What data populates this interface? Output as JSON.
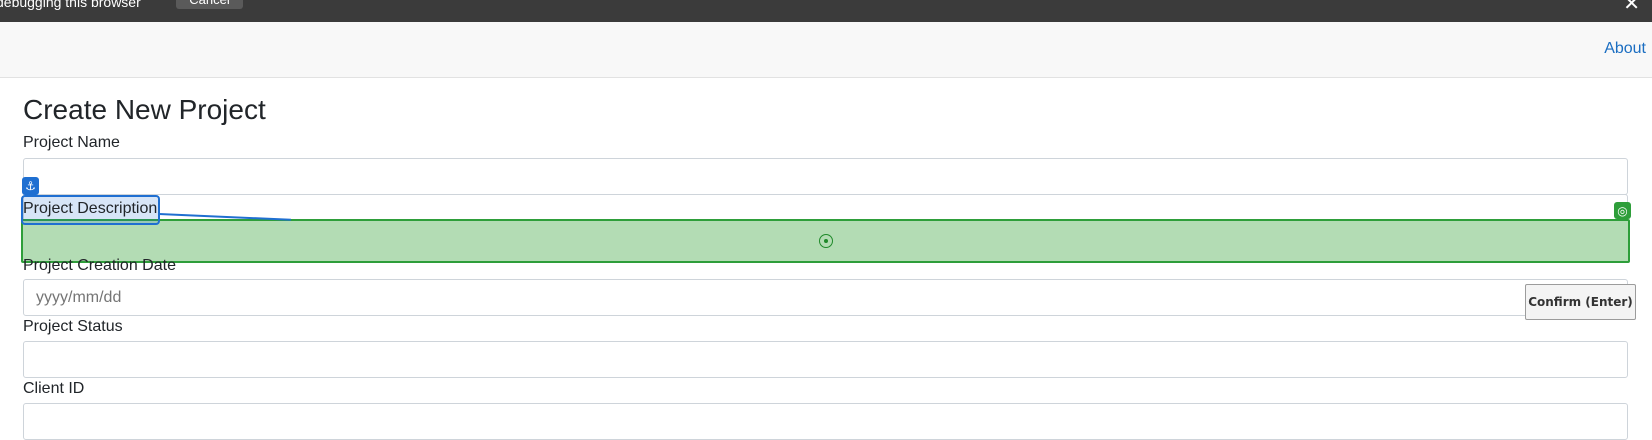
{
  "debug_bar": {
    "message": "debugging this browser",
    "cancel_label": "Cancel",
    "close_glyph": "✕"
  },
  "navbar": {
    "about_label": "About"
  },
  "page": {
    "title": "Create New Project"
  },
  "form": {
    "fields": [
      {
        "label": "Project Name",
        "value": "",
        "placeholder": ""
      },
      {
        "label": "Project Description",
        "value": "",
        "placeholder": ""
      },
      {
        "label": "Project Creation Date",
        "value": "",
        "placeholder": "yyyy/mm/dd"
      },
      {
        "label": "Project Status",
        "value": "",
        "placeholder": ""
      },
      {
        "label": "Client ID",
        "value": "",
        "placeholder": ""
      }
    ]
  },
  "overlay": {
    "anchor_glyph": "⚓",
    "target_glyph": "◎",
    "confirm_label": "Confirm (Enter)"
  },
  "colors": {
    "accent": "#1b6ec2",
    "anchor": "#1f6fd1",
    "target": "#2e9e3a",
    "target_fill": "#b3dcb4"
  },
  "icons": [
    "anchor-icon",
    "target-icon",
    "crosshair-icon",
    "close-icon"
  ]
}
